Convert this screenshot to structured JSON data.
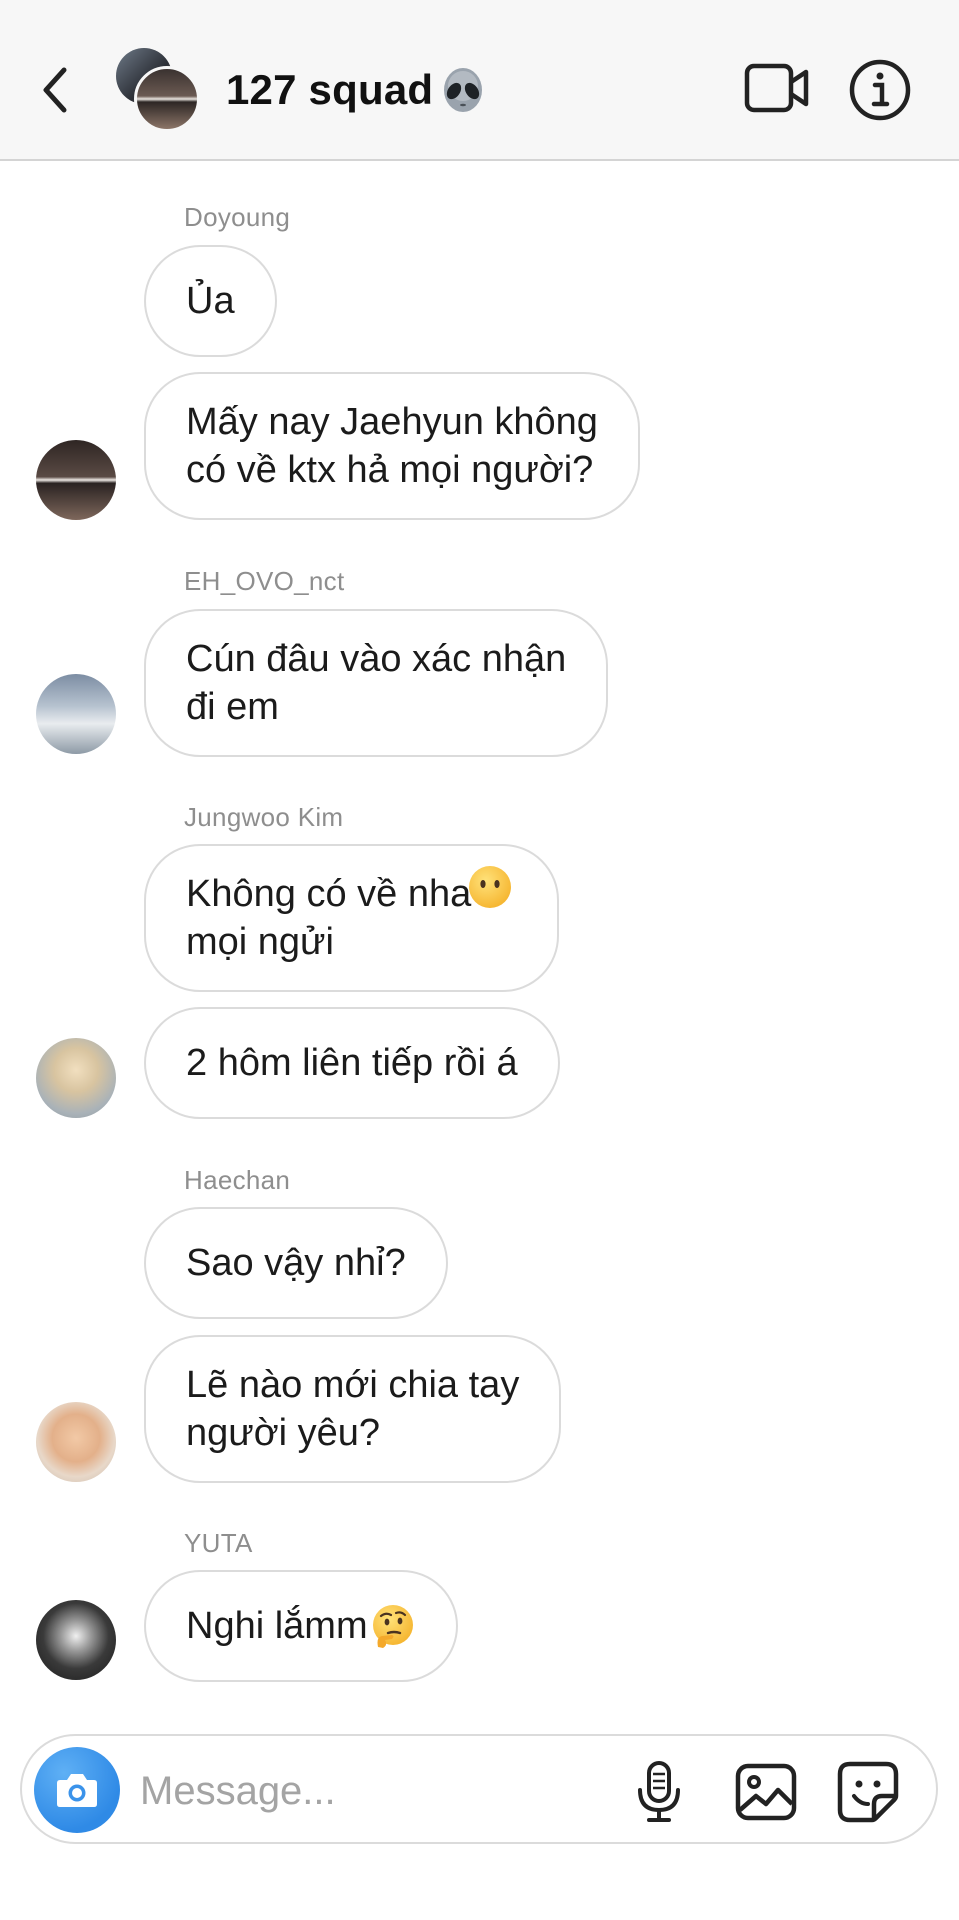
{
  "header": {
    "title": "127 squad",
    "title_emoji": "alien-emoji",
    "icons": [
      "back-icon",
      "video-call-icon",
      "info-icon"
    ]
  },
  "messages": [
    {
      "sender": "Doyoung",
      "bubbles": [
        "Ủa",
        "Mấy nay Jaehyun không\ncó về ktx hả mọi người?"
      ]
    },
    {
      "sender": "EH_OVO_nct",
      "bubbles": [
        "Cún đâu vào xác nhận\nđi em"
      ]
    },
    {
      "sender": "Jungwoo Kim",
      "bubbles": [
        "Không có về nha\nmọi ngửi",
        "2 hôm liên tiếp rồi á"
      ],
      "emoji": "no-mouth-face-emoji"
    },
    {
      "sender": "Haechan",
      "bubbles": [
        "Sao vậy nhỉ?",
        "Lẽ nào mới chia tay\nngười yêu?"
      ]
    },
    {
      "sender": "YUTA",
      "bubbles": [
        "Nghi lắmm"
      ],
      "emoji": "thinking-face-emoji"
    }
  ],
  "composer": {
    "placeholder": "Message...",
    "icons": [
      "camera-icon",
      "microphone-icon",
      "gallery-icon",
      "sticker-icon"
    ]
  },
  "colors": {
    "header_bg": "#f7f7f7",
    "bubble_border": "#dbdbdb",
    "sender_text": "#8e8e8e",
    "camera_blue": "#3897f0"
  }
}
